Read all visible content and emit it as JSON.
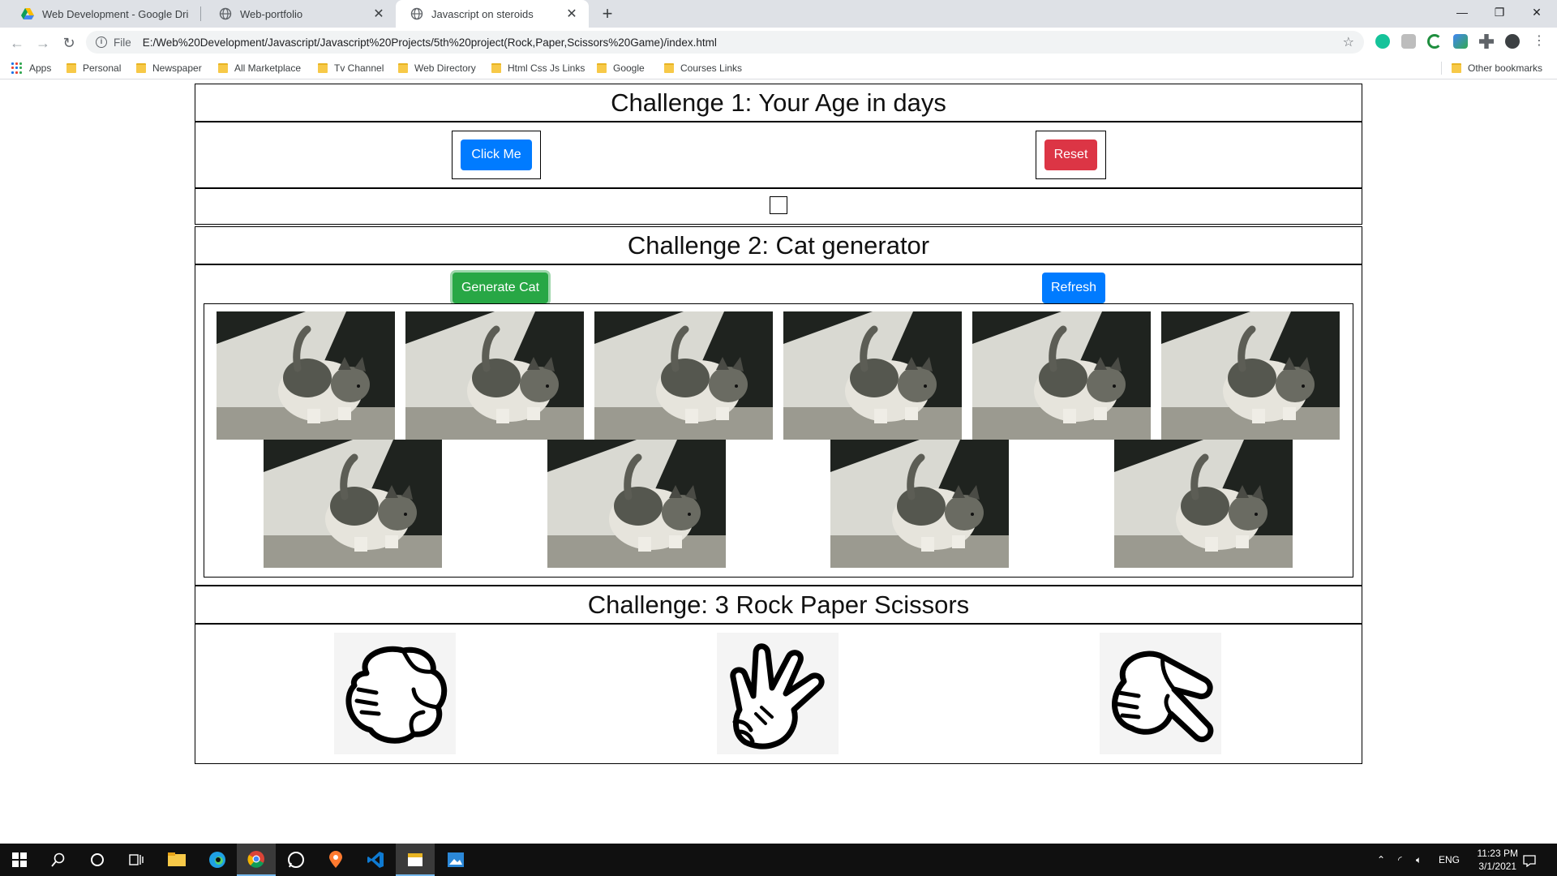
{
  "browser": {
    "tabs": [
      {
        "title": "Web Development - Google Driv",
        "icon": "google-drive-icon"
      },
      {
        "title": "Web-portfolio",
        "icon": "globe-icon"
      },
      {
        "title": "Javascript on steroids",
        "icon": "globe-icon",
        "active": true
      }
    ],
    "address": {
      "scheme": "File",
      "url": "E:/Web%20Development/Javascript/Javascript%20Projects/5th%20project(Rock,Paper,Scissors%20Game)/index.html"
    },
    "bookmarks": [
      "Apps",
      "Personal",
      "Newspaper",
      "All Marketplace",
      "Tv Channel",
      "Web Directory",
      "Html Css Js Links",
      "Google",
      "Courses Links"
    ],
    "other_bookmarks": "Other bookmarks"
  },
  "challenge1": {
    "title": "Challenge 1: Your Age in days",
    "click_label": "Click Me",
    "reset_label": "Reset"
  },
  "challenge2": {
    "title": "Challenge 2: Cat generator",
    "generate_label": "Generate Cat",
    "refresh_label": "Refresh",
    "cat_count": 10
  },
  "challenge3": {
    "title": "Challenge: 3 Rock Paper Scissors",
    "choices": [
      "rock",
      "paper",
      "scissors"
    ]
  },
  "taskbar": {
    "language": "ENG",
    "time": "11:23 PM",
    "date": "3/1/2021"
  },
  "colors": {
    "primary": "#007bff",
    "danger": "#dc3545",
    "success": "#28a745"
  }
}
